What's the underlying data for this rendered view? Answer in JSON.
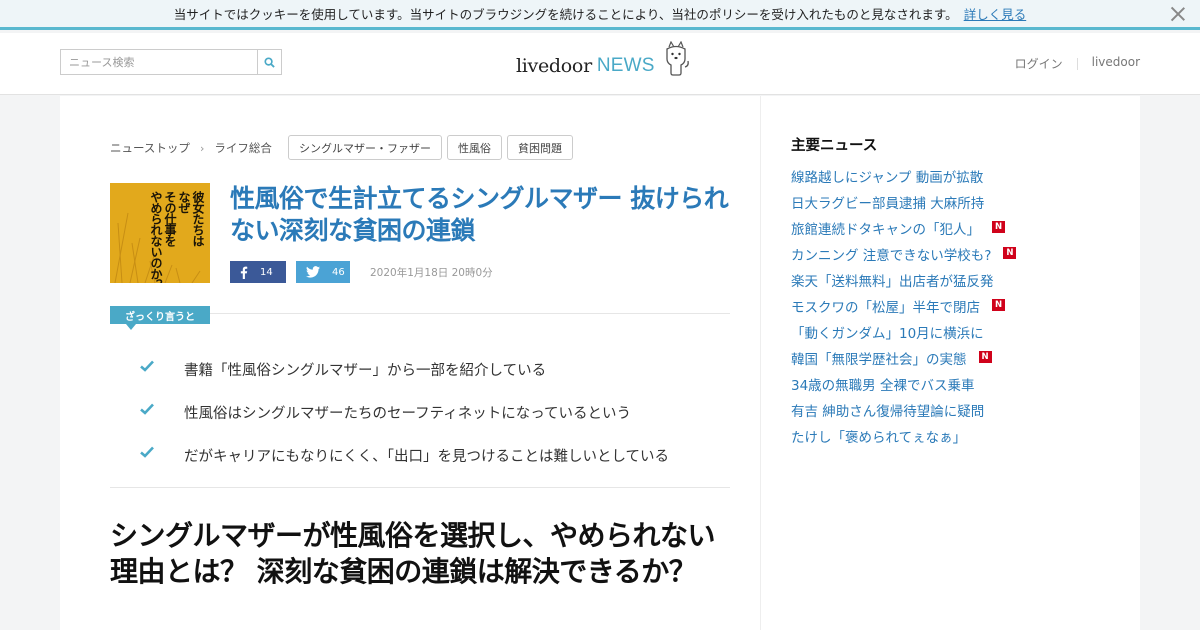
{
  "cookie_bar": {
    "message": "当サイトではクッキーを使用しています。当サイトのブラウジングを続けることにより、当社のポリシーを受け入れたものと見なされます。",
    "link_label": "詳しく見る"
  },
  "header": {
    "search_placeholder": "ニュース検索",
    "logo_main": "livedoor",
    "logo_sub": "NEWS",
    "login_label": "ログイン",
    "livedoor_label": "livedoor"
  },
  "breadcrumb": {
    "items": [
      "ニューストップ",
      "ライフ総合"
    ],
    "separator": "›"
  },
  "tags": [
    "シングルマザー・ファザー",
    "性風俗",
    "貧困問題"
  ],
  "thumbnail": {
    "columns": [
      "彼女たちは",
      "なぜ",
      "その仕事を",
      "やめられないのか？"
    ]
  },
  "article": {
    "title": "性風俗で生計立てるシングルマザー 抜けられない深刻な貧困の連鎖",
    "facebook_count": "14",
    "twitter_count": "46",
    "date": "2020年1月18日 20時0分",
    "summary_label": "ざっくり言うと",
    "summary_points": [
      "書籍「性風俗シングルマザー」から一部を紹介している",
      "性風俗はシングルマザーたちのセーフティネットになっているという",
      "だがキャリアにもなりにくく、「出口」を見つけることは難しいとしている"
    ],
    "headline": "シングルマザーが性風俗を選択し、やめられない理由とは？ 深刻な貧困の連鎖は解決できるか？"
  },
  "sidebar": {
    "title": "主要ニュース",
    "new_badge": "N",
    "items": [
      {
        "text": "線路越しにジャンプ 動画が拡散",
        "new": false
      },
      {
        "text": "日大ラグビー部員逮捕 大麻所持",
        "new": false
      },
      {
        "text": "旅館連続ドタキャンの「犯人」",
        "new": true
      },
      {
        "text": "カンニング 注意できない学校も?",
        "new": true
      },
      {
        "text": "楽天「送料無料」出店者が猛反発",
        "new": false
      },
      {
        "text": "モスクワの「松屋」半年で閉店",
        "new": true
      },
      {
        "text": "「動くガンダム」10月に横浜に",
        "new": false
      },
      {
        "text": "韓国「無限学歴社会」の実態",
        "new": true
      },
      {
        "text": "34歳の無職男 全裸でバス乗車",
        "new": false
      },
      {
        "text": "有吉 紳助さん復帰待望論に疑問",
        "new": false
      },
      {
        "text": "たけし「褒められてぇなぁ」",
        "new": false
      }
    ]
  },
  "colors": {
    "accent": "#4aa9c7",
    "link": "#2b7ab8",
    "facebook": "#3b5998",
    "twitter": "#4ba3d5",
    "new_badge": "#d0021b",
    "thumbnail_bg": "#e2a91c"
  },
  "icons": {
    "search": "search-icon",
    "close": "close-icon",
    "facebook": "facebook-icon",
    "twitter": "twitter-icon",
    "check": "check-icon",
    "mascot": "dog-mascot-icon"
  }
}
